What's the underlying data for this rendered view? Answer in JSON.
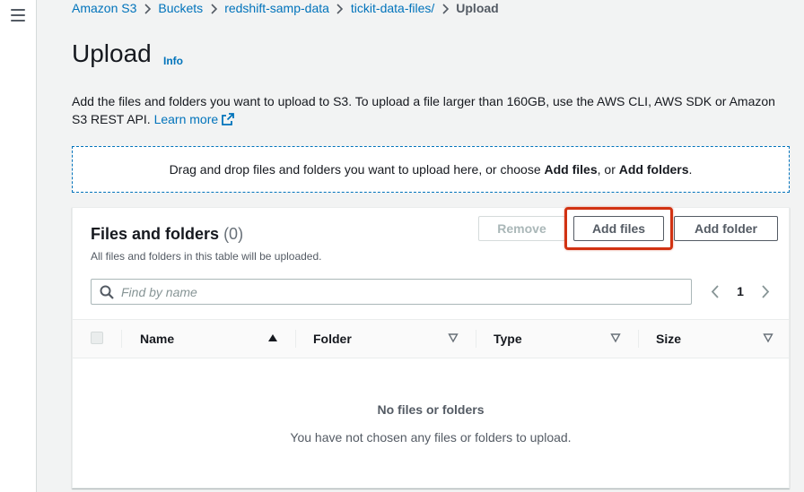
{
  "breadcrumb": {
    "items": [
      "Amazon S3",
      "Buckets",
      "redshift-samp-data",
      "tickit-data-files/"
    ],
    "current": "Upload"
  },
  "header": {
    "title": "Upload",
    "info_label": "Info"
  },
  "description": {
    "text": "Add the files and folders you want to upload to S3. To upload a file larger than 160GB, use the AWS CLI, AWS SDK or Amazon S3 REST API.",
    "learn_more": "Learn more"
  },
  "dropzone": {
    "prefix": "Drag and drop files and folders you want to upload here, or choose",
    "add_files": "Add files",
    "separator": ", or",
    "add_folders": "Add folders",
    "suffix": "."
  },
  "files_panel": {
    "title": "Files and folders",
    "count": "(0)",
    "subtitle": "All files and folders in this table will be uploaded.",
    "remove_label": "Remove",
    "add_files_label": "Add files",
    "add_folder_label": "Add folder",
    "search_placeholder": "Find by name",
    "page_number": "1",
    "columns": [
      "Name",
      "Folder",
      "Type",
      "Size"
    ],
    "empty_title": "No files or folders",
    "empty_subtitle": "You have not chosen any files or folders to upload."
  },
  "colors": {
    "link": "#0073bb",
    "highlight": "#d13212",
    "text": "#16191f",
    "muted": "#545b64",
    "background": "#f2f3f3"
  },
  "icons": [
    "menu-icon",
    "chevron-right-icon",
    "external-link-icon",
    "search-icon",
    "chevron-left-icon",
    "sort-ascending-icon",
    "sort-descending-icon"
  ]
}
